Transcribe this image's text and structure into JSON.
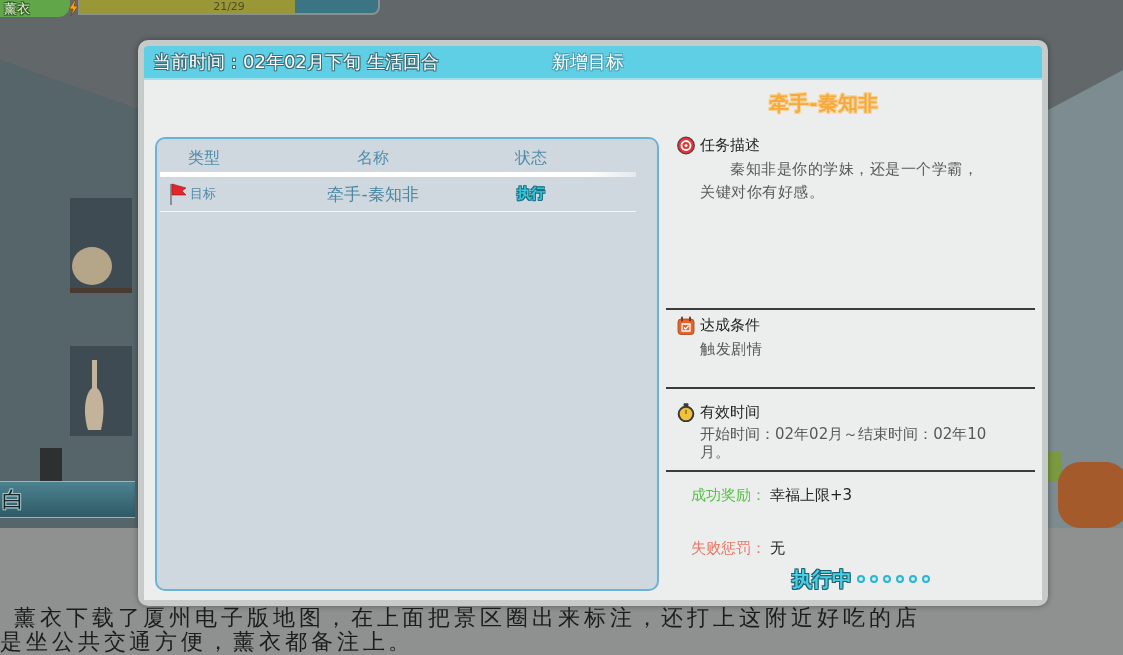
{
  "hud": {
    "name": "薰衣",
    "stamina": {
      "reading": "21/29",
      "level": 0.72
    }
  },
  "scene_dialogue": {
    "speaker": "白",
    "lines": [
      "薰衣下载了厦州电子版地图，在上面把景区圈出来标注，还打上这附近好吃的店",
      "是坐公共交通方便，薰衣都备注上。"
    ]
  },
  "window": {
    "current_time": "当前时间：02年02月下旬 生活回合",
    "title": "新增目标"
  },
  "task_list": {
    "columns": [
      "类型",
      "名称",
      "状态"
    ],
    "rows": [
      {
        "type": "目标",
        "name": "牵手-秦知非",
        "status": "执行"
      }
    ]
  },
  "task_detail": {
    "title": "牵手-秦知非",
    "sections": [
      {
        "kind": "description",
        "heading": "任务描述",
        "text": "秦知非是你的学妹，还是一个学霸，关键对你有好感。"
      },
      {
        "kind": "condition",
        "heading": "达成条件",
        "text": "触发剧情"
      },
      {
        "kind": "time",
        "heading": "有效时间",
        "text": "开始时间：02年02月～结束时间：02年10月。"
      }
    ],
    "reward": {
      "label": "成功奖励：",
      "value": "幸福上限+3"
    },
    "penalty": {
      "label": "失败惩罚：",
      "value": "无"
    },
    "progress": {
      "label": "执行中"
    }
  }
}
